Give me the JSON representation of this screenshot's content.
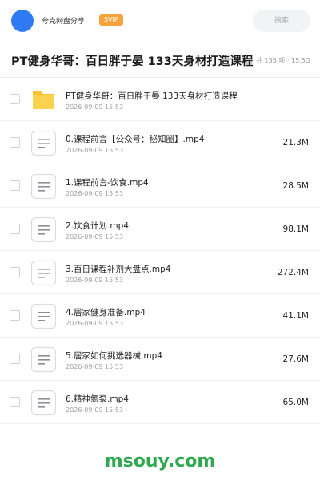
{
  "header": {
    "share_name": "夸克网盘分享",
    "badge": "SVIP",
    "search_placeholder": "搜索",
    "avatar_color": "#2f7bf5"
  },
  "title_bar": {
    "title": "PT健身华哥：百日胖于晏 133天身材打造课程",
    "count": "共 135 项 · 15.5G"
  },
  "files": [
    {
      "name": "PT健身华哥：百日胖于晏 133天身材打造课程",
      "date": "2026-09-09 15:53",
      "size": "",
      "type": "folder"
    },
    {
      "name": "0.课程前言【公众号：秘知圈】.mp4",
      "date": "2026-09-09 15:53",
      "size": "21.3M",
      "type": "file"
    },
    {
      "name": "1.课程前言-饮食.mp4",
      "date": "2026-09-09 15:53",
      "size": "28.5M",
      "type": "file"
    },
    {
      "name": "2.饮食计划.mp4",
      "date": "2026-09-09 15:53",
      "size": "98.1M",
      "type": "file"
    },
    {
      "name": "3.百日课程补剂大盘点.mp4",
      "date": "2026-09-09 15:53",
      "size": "272.4M",
      "type": "file"
    },
    {
      "name": "4.居家健身准备.mp4",
      "date": "2026-09-09 15:53",
      "size": "41.1M",
      "type": "file"
    },
    {
      "name": "5.居家如何挑选器械.mp4",
      "date": "2026-09-09 15:53",
      "size": "27.6M",
      "type": "file"
    },
    {
      "name": "6.精神氮泵.mp4",
      "date": "2026-09-09 15:53",
      "size": "65.0M",
      "type": "file"
    }
  ],
  "footer": {
    "watermark": "msouy.com"
  },
  "colors": {
    "folder": "#f9c22e",
    "badge": "#f7a23b",
    "watermark": "#2fa84f"
  }
}
